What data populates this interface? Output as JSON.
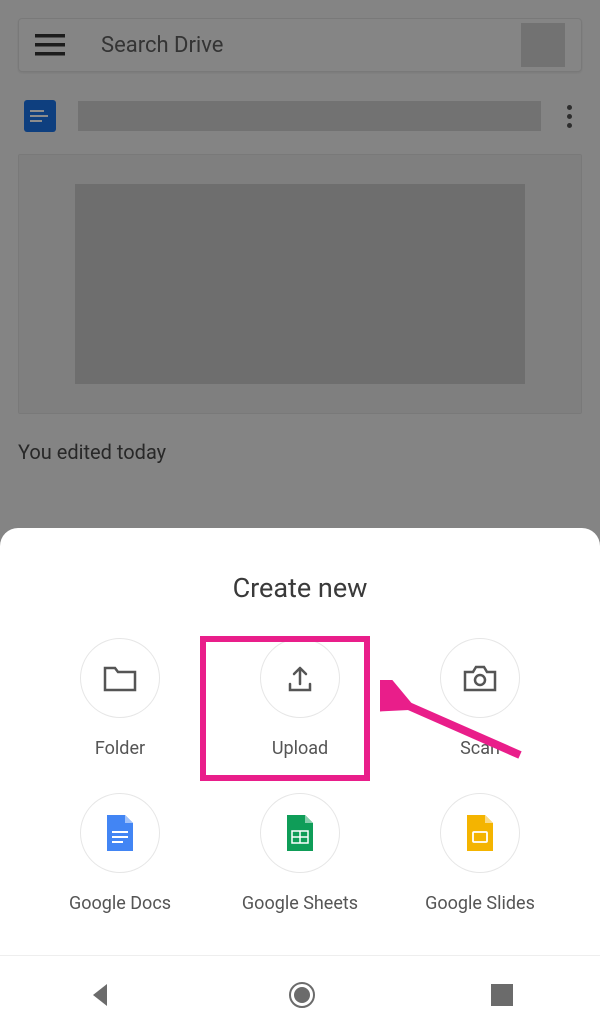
{
  "header": {
    "search_placeholder": "Search Drive"
  },
  "file": {
    "edited_text": "You edited today"
  },
  "sheet": {
    "title": "Create new",
    "items": [
      {
        "label": "Folder"
      },
      {
        "label": "Upload"
      },
      {
        "label": "Scan"
      },
      {
        "label": "Google Docs"
      },
      {
        "label": "Google Sheets"
      },
      {
        "label": "Google Slides"
      }
    ]
  },
  "annotation": {
    "highlight_target": "upload",
    "highlight_color": "#e91e8a"
  }
}
